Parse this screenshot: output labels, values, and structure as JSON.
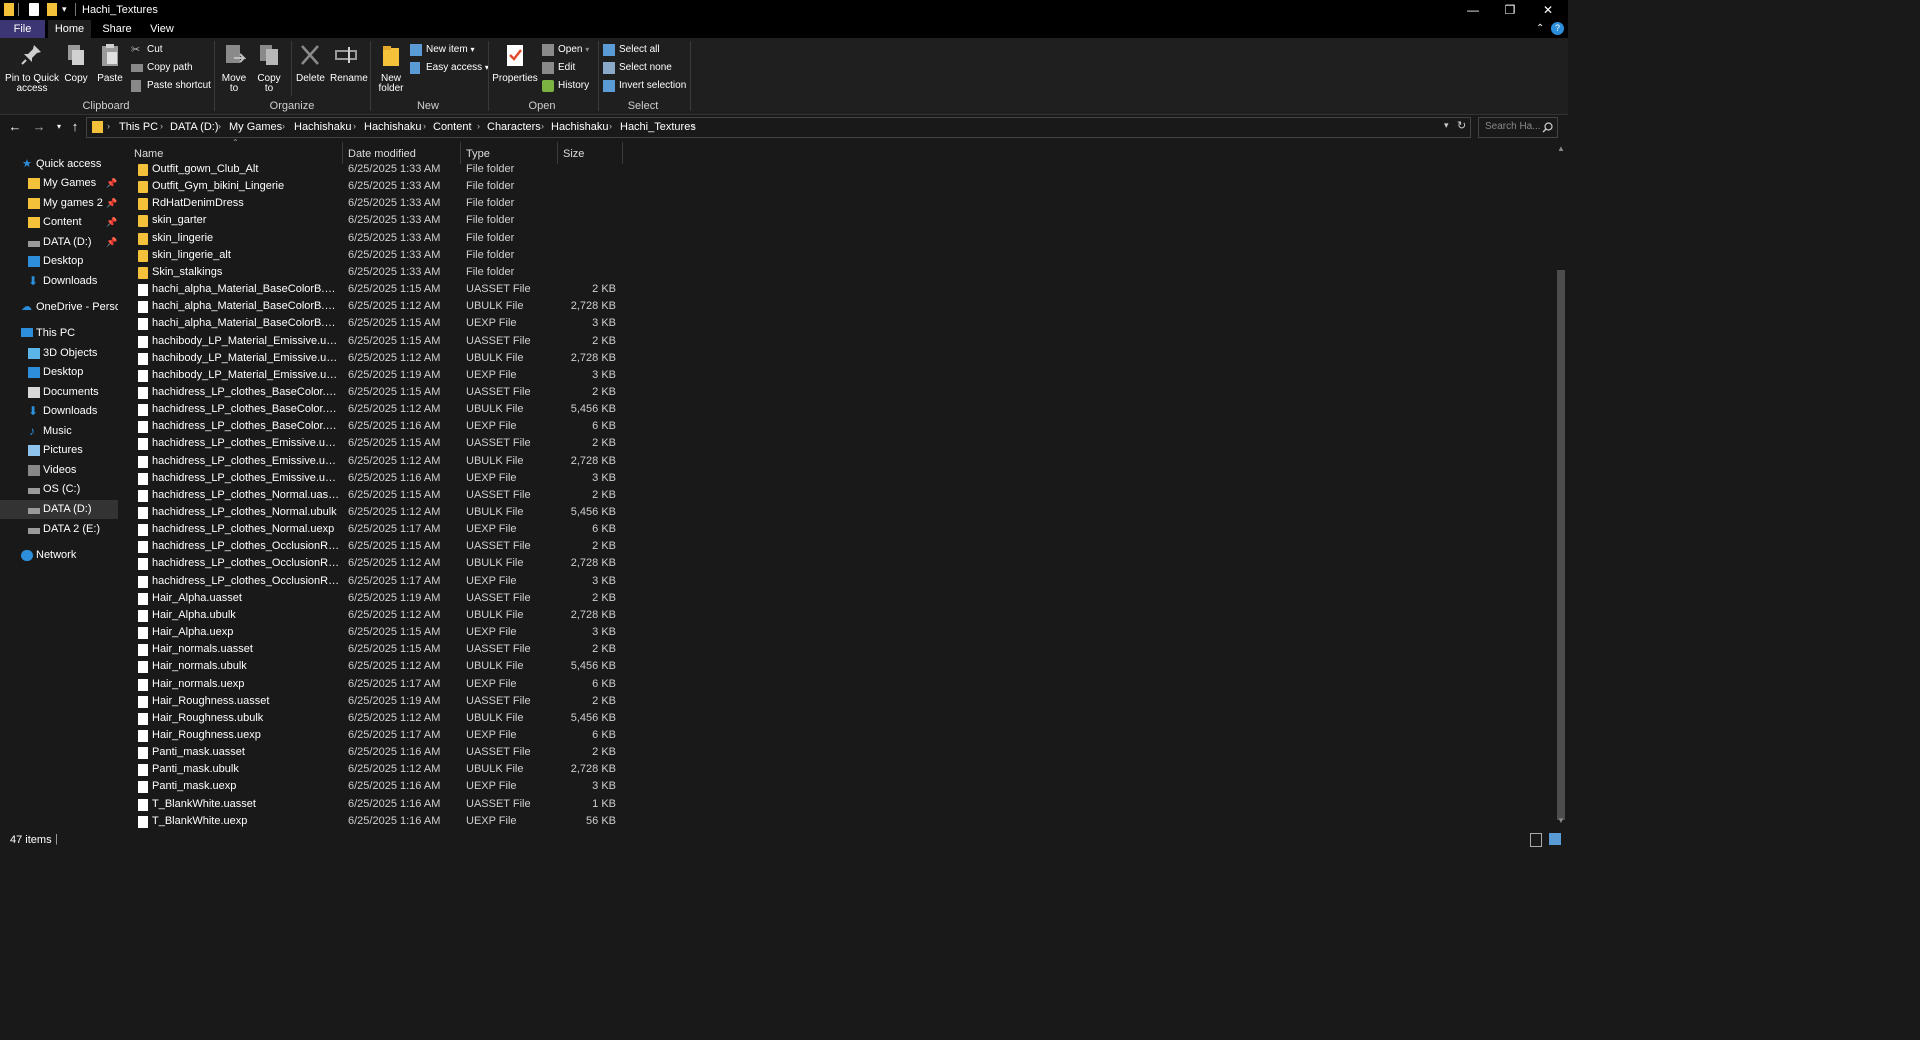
{
  "window": {
    "title": "Hachi_Textures",
    "minimize": "—",
    "maximize": "❐",
    "close": "✕"
  },
  "ribbon_tabs": {
    "file": "File",
    "home": "Home",
    "share": "Share",
    "view": "View"
  },
  "ribbon": {
    "clipboard": {
      "label": "Clipboard",
      "pin": "Pin to Quick access",
      "pin_l1": "Pin to Quick",
      "pin_l2": "access",
      "copy": "Copy",
      "paste": "Paste",
      "cut": "Cut",
      "copy_path": "Copy path",
      "paste_shortcut": "Paste shortcut"
    },
    "organize": {
      "label": "Organize",
      "move_l1": "Move",
      "move_l2": "to",
      "copy_l1": "Copy",
      "copy_l2": "to",
      "delete": "Delete",
      "rename": "Rename"
    },
    "new": {
      "label": "New",
      "new_folder_l1": "New",
      "new_folder_l2": "folder",
      "new_item": "New item",
      "easy_access": "Easy access"
    },
    "open": {
      "label": "Open",
      "properties": "Properties",
      "open": "Open",
      "edit": "Edit",
      "history": "History"
    },
    "select": {
      "label": "Select",
      "select_all": "Select all",
      "select_none": "Select none",
      "invert": "Invert selection"
    }
  },
  "address": {
    "crumbs": [
      "This PC",
      "DATA (D:)",
      "My Games",
      "Hachishaku",
      "Hachishaku",
      "Content",
      "Characters",
      "Hachishaku",
      "Hachi_Textures"
    ],
    "search_placeholder": "Search Ha..."
  },
  "nav": {
    "quick_access": "Quick access",
    "my_games": "My Games",
    "my_games2": "My games 2",
    "content": "Content",
    "data_d_pinned": "DATA (D:)",
    "desktop_qa": "Desktop",
    "downloads_qa": "Downloads",
    "onedrive": "OneDrive - Personal",
    "this_pc": "This PC",
    "objects3d": "3D Objects",
    "desktop": "Desktop",
    "documents": "Documents",
    "downloads": "Downloads",
    "music": "Music",
    "pictures": "Pictures",
    "videos": "Videos",
    "os_c": "OS (C:)",
    "data_d": "DATA (D:)",
    "data2_e": "DATA 2 (E:)",
    "network": "Network"
  },
  "columns": {
    "name": "Name",
    "date": "Date modified",
    "type": "Type",
    "size": "Size"
  },
  "files": [
    {
      "name": "Outfit_gown_Club_Alt",
      "date": "6/25/2025 1:33 AM",
      "type": "File folder",
      "size": "",
      "kind": "folder"
    },
    {
      "name": "Outfit_Gym_bikini_Lingerie",
      "date": "6/25/2025 1:33 AM",
      "type": "File folder",
      "size": "",
      "kind": "folder"
    },
    {
      "name": "RdHatDenimDress",
      "date": "6/25/2025 1:33 AM",
      "type": "File folder",
      "size": "",
      "kind": "folder"
    },
    {
      "name": "skin_garter",
      "date": "6/25/2025 1:33 AM",
      "type": "File folder",
      "size": "",
      "kind": "folder"
    },
    {
      "name": "skin_lingerie",
      "date": "6/25/2025 1:33 AM",
      "type": "File folder",
      "size": "",
      "kind": "folder"
    },
    {
      "name": "skin_lingerie_alt",
      "date": "6/25/2025 1:33 AM",
      "type": "File folder",
      "size": "",
      "kind": "folder"
    },
    {
      "name": "Skin_stalkings",
      "date": "6/25/2025 1:33 AM",
      "type": "File folder",
      "size": "",
      "kind": "folder"
    },
    {
      "name": "hachi_alpha_Material_BaseColorB.uasset",
      "date": "6/25/2025 1:15 AM",
      "type": "UASSET File",
      "size": "2 KB",
      "kind": "file"
    },
    {
      "name": "hachi_alpha_Material_BaseColorB.ubulk",
      "date": "6/25/2025 1:12 AM",
      "type": "UBULK File",
      "size": "2,728 KB",
      "kind": "file"
    },
    {
      "name": "hachi_alpha_Material_BaseColorB.uexp",
      "date": "6/25/2025 1:15 AM",
      "type": "UEXP File",
      "size": "3 KB",
      "kind": "file"
    },
    {
      "name": "hachibody_LP_Material_Emissive.uasset",
      "date": "6/25/2025 1:15 AM",
      "type": "UASSET File",
      "size": "2 KB",
      "kind": "file"
    },
    {
      "name": "hachibody_LP_Material_Emissive.ubulk",
      "date": "6/25/2025 1:12 AM",
      "type": "UBULK File",
      "size": "2,728 KB",
      "kind": "file"
    },
    {
      "name": "hachibody_LP_Material_Emissive.uexp",
      "date": "6/25/2025 1:19 AM",
      "type": "UEXP File",
      "size": "3 KB",
      "kind": "file"
    },
    {
      "name": "hachidress_LP_clothes_BaseColor.uasset",
      "date": "6/25/2025 1:15 AM",
      "type": "UASSET File",
      "size": "2 KB",
      "kind": "file"
    },
    {
      "name": "hachidress_LP_clothes_BaseColor.ubulk",
      "date": "6/25/2025 1:12 AM",
      "type": "UBULK File",
      "size": "5,456 KB",
      "kind": "file"
    },
    {
      "name": "hachidress_LP_clothes_BaseColor.uexp",
      "date": "6/25/2025 1:16 AM",
      "type": "UEXP File",
      "size": "6 KB",
      "kind": "file"
    },
    {
      "name": "hachidress_LP_clothes_Emissive.uasset",
      "date": "6/25/2025 1:15 AM",
      "type": "UASSET File",
      "size": "2 KB",
      "kind": "file"
    },
    {
      "name": "hachidress_LP_clothes_Emissive.ubulk",
      "date": "6/25/2025 1:12 AM",
      "type": "UBULK File",
      "size": "2,728 KB",
      "kind": "file"
    },
    {
      "name": "hachidress_LP_clothes_Emissive.uexp",
      "date": "6/25/2025 1:16 AM",
      "type": "UEXP File",
      "size": "3 KB",
      "kind": "file"
    },
    {
      "name": "hachidress_LP_clothes_Normal.uasset",
      "date": "6/25/2025 1:15 AM",
      "type": "UASSET File",
      "size": "2 KB",
      "kind": "file"
    },
    {
      "name": "hachidress_LP_clothes_Normal.ubulk",
      "date": "6/25/2025 1:12 AM",
      "type": "UBULK File",
      "size": "5,456 KB",
      "kind": "file"
    },
    {
      "name": "hachidress_LP_clothes_Normal.uexp",
      "date": "6/25/2025 1:17 AM",
      "type": "UEXP File",
      "size": "6 KB",
      "kind": "file"
    },
    {
      "name": "hachidress_LP_clothes_OcclusionRoughn...",
      "date": "6/25/2025 1:15 AM",
      "type": "UASSET File",
      "size": "2 KB",
      "kind": "file"
    },
    {
      "name": "hachidress_LP_clothes_OcclusionRoughn...",
      "date": "6/25/2025 1:12 AM",
      "type": "UBULK File",
      "size": "2,728 KB",
      "kind": "file"
    },
    {
      "name": "hachidress_LP_clothes_OcclusionRoughn...",
      "date": "6/25/2025 1:17 AM",
      "type": "UEXP File",
      "size": "3 KB",
      "kind": "file"
    },
    {
      "name": "Hair_Alpha.uasset",
      "date": "6/25/2025 1:19 AM",
      "type": "UASSET File",
      "size": "2 KB",
      "kind": "file"
    },
    {
      "name": "Hair_Alpha.ubulk",
      "date": "6/25/2025 1:12 AM",
      "type": "UBULK File",
      "size": "2,728 KB",
      "kind": "file"
    },
    {
      "name": "Hair_Alpha.uexp",
      "date": "6/25/2025 1:15 AM",
      "type": "UEXP File",
      "size": "3 KB",
      "kind": "file"
    },
    {
      "name": "Hair_normals.uasset",
      "date": "6/25/2025 1:15 AM",
      "type": "UASSET File",
      "size": "2 KB",
      "kind": "file"
    },
    {
      "name": "Hair_normals.ubulk",
      "date": "6/25/2025 1:12 AM",
      "type": "UBULK File",
      "size": "5,456 KB",
      "kind": "file"
    },
    {
      "name": "Hair_normals.uexp",
      "date": "6/25/2025 1:17 AM",
      "type": "UEXP File",
      "size": "6 KB",
      "kind": "file"
    },
    {
      "name": "Hair_Roughness.uasset",
      "date": "6/25/2025 1:19 AM",
      "type": "UASSET File",
      "size": "2 KB",
      "kind": "file"
    },
    {
      "name": "Hair_Roughness.ubulk",
      "date": "6/25/2025 1:12 AM",
      "type": "UBULK File",
      "size": "5,456 KB",
      "kind": "file"
    },
    {
      "name": "Hair_Roughness.uexp",
      "date": "6/25/2025 1:17 AM",
      "type": "UEXP File",
      "size": "6 KB",
      "kind": "file"
    },
    {
      "name": "Panti_mask.uasset",
      "date": "6/25/2025 1:16 AM",
      "type": "UASSET File",
      "size": "2 KB",
      "kind": "file"
    },
    {
      "name": "Panti_mask.ubulk",
      "date": "6/25/2025 1:12 AM",
      "type": "UBULK File",
      "size": "2,728 KB",
      "kind": "file"
    },
    {
      "name": "Panti_mask.uexp",
      "date": "6/25/2025 1:16 AM",
      "type": "UEXP File",
      "size": "3 KB",
      "kind": "file"
    },
    {
      "name": "T_BlankWhite.uasset",
      "date": "6/25/2025 1:16 AM",
      "type": "UASSET File",
      "size": "1 KB",
      "kind": "file"
    },
    {
      "name": "T_BlankWhite.uexp",
      "date": "6/25/2025 1:16 AM",
      "type": "UEXP File",
      "size": "56 KB",
      "kind": "file"
    }
  ],
  "status": {
    "items": "47 items"
  },
  "colors": {
    "file_tab": "#3c3675",
    "folder": "#f3c13a",
    "accent_blue": "#2d8fdb"
  }
}
